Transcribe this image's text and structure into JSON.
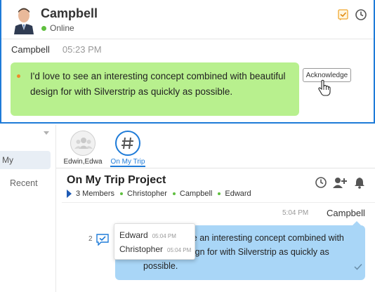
{
  "top": {
    "contact_name": "Campbell",
    "status": "Online",
    "sender_name": "Campbell",
    "sender_time": "05:23 PM",
    "message": "I'd love to see an interesting concept combined with beautiful design for with Silverstrip as quickly as possible.",
    "acknowledge_label": "Acknowledge"
  },
  "sidebar": {
    "my_label": "My",
    "recent_label": "Recent"
  },
  "tabs": [
    {
      "label": "Edwin,Edwa"
    },
    {
      "label": "On My Trip"
    }
  ],
  "group": {
    "title": "On My Trip Project",
    "members_count": "3 Members",
    "members": [
      "Christopher",
      "Campbell",
      "Edward"
    ],
    "message_time": "5:04 PM",
    "message_sender": "Campbell",
    "message": "I'd love to see an interesting concept combined with beautiful design for with Silverstrip as quickly as possible.",
    "read_count": "2"
  },
  "read_by": [
    {
      "name": "Edward",
      "time": "05:04 PM"
    },
    {
      "name": "Christopher",
      "time": "05:04 PM"
    }
  ],
  "colors": {
    "accent": "#1e7bd8",
    "green_bubble": "#b8f08e",
    "blue_bubble": "#a9d6f7",
    "online": "#5fbf3f"
  }
}
